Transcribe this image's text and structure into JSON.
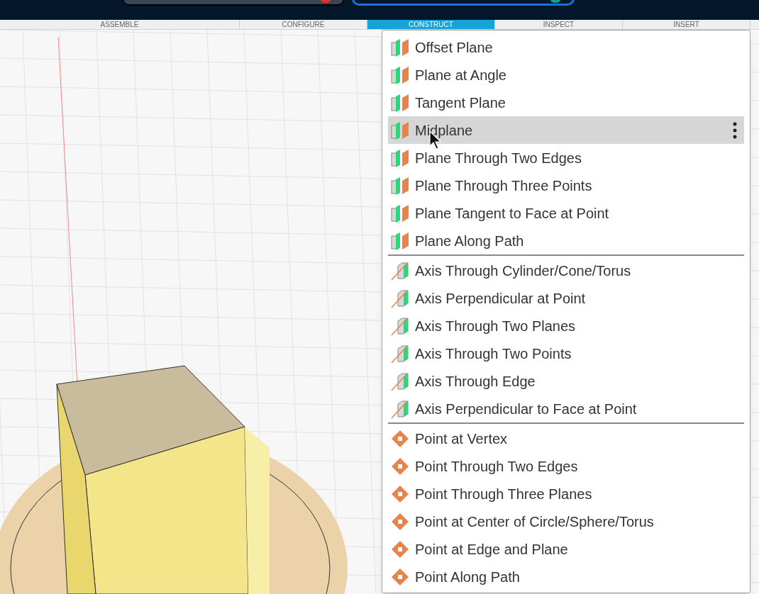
{
  "tabs": [
    {
      "label": "ASSEMBLE",
      "selected": false
    },
    {
      "label": "CONFIGURE",
      "selected": false
    },
    {
      "label": "CONSTRUCT",
      "selected": true
    },
    {
      "label": "INSPECT",
      "selected": false
    },
    {
      "label": "INSERT",
      "selected": false
    }
  ],
  "menu": {
    "groups": [
      {
        "kind": "plane",
        "items": [
          {
            "label": "Offset Plane",
            "selected": false
          },
          {
            "label": "Plane at Angle",
            "selected": false
          },
          {
            "label": "Tangent Plane",
            "selected": false
          },
          {
            "label": "Midplane",
            "selected": true
          },
          {
            "label": "Plane Through Two Edges",
            "selected": false
          },
          {
            "label": "Plane Through Three Points",
            "selected": false
          },
          {
            "label": "Plane Tangent to Face at Point",
            "selected": false
          },
          {
            "label": "Plane Along Path",
            "selected": false
          }
        ]
      },
      {
        "kind": "axis",
        "items": [
          {
            "label": "Axis Through Cylinder/Cone/Torus",
            "selected": false
          },
          {
            "label": "Axis Perpendicular at Point",
            "selected": false
          },
          {
            "label": "Axis Through Two Planes",
            "selected": false
          },
          {
            "label": "Axis Through Two Points",
            "selected": false
          },
          {
            "label": "Axis Through Edge",
            "selected": false
          },
          {
            "label": "Axis Perpendicular to Face at Point",
            "selected": false
          }
        ]
      },
      {
        "kind": "point",
        "items": [
          {
            "label": "Point at Vertex",
            "selected": false
          },
          {
            "label": "Point Through Two Edges",
            "selected": false
          },
          {
            "label": "Point Through Three Planes",
            "selected": false
          },
          {
            "label": "Point at Center of Circle/Sphere/Torus",
            "selected": false
          },
          {
            "label": "Point at Edge and Plane",
            "selected": false
          },
          {
            "label": "Point Along Path",
            "selected": false
          }
        ]
      }
    ]
  }
}
